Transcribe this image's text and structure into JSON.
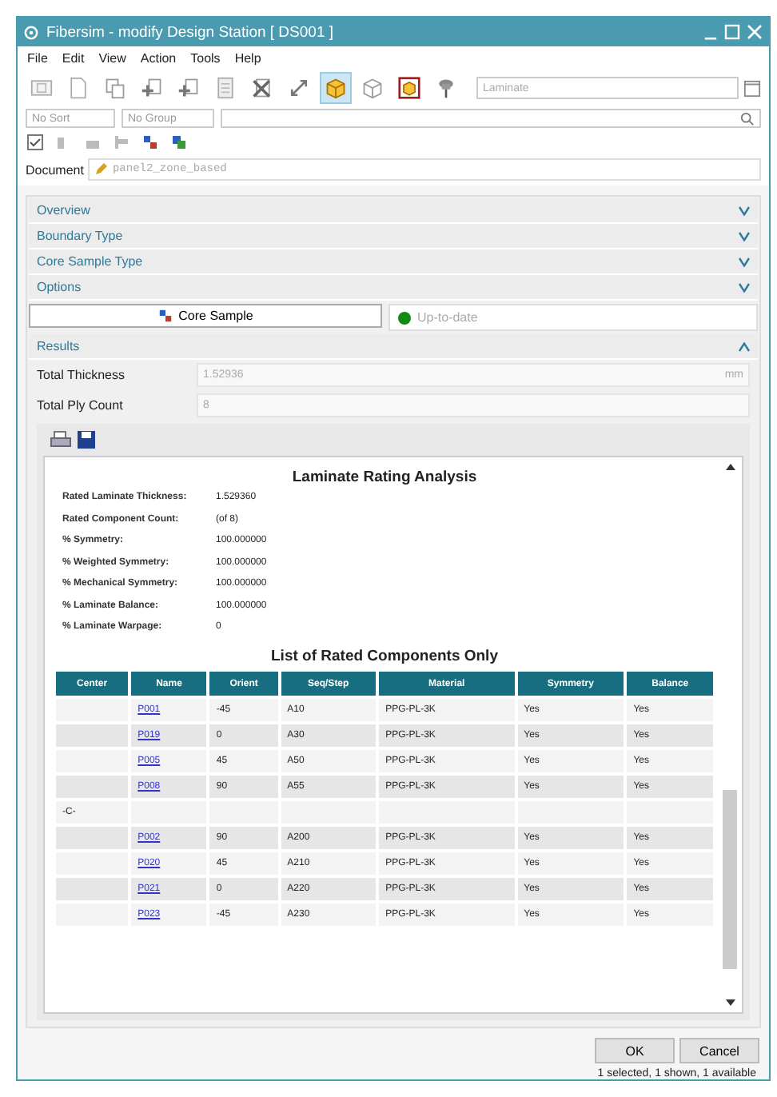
{
  "window": {
    "title": "Fibersim - modify Design Station [ DS001 ]"
  },
  "menu": [
    "File",
    "Edit",
    "View",
    "Action",
    "Tools",
    "Help"
  ],
  "toolbar": [
    {
      "kind": "id",
      "selected": false
    },
    {
      "kind": "page",
      "selected": false
    },
    {
      "kind": "copy",
      "selected": false
    },
    {
      "kind": "add",
      "selected": false
    },
    {
      "kind": "add",
      "selected": false
    },
    {
      "kind": "doc",
      "selected": false
    },
    {
      "kind": "delete",
      "selected": false
    },
    {
      "kind": "move",
      "selected": false
    },
    {
      "kind": "cube-solid",
      "selected": true
    },
    {
      "kind": "cube-wire",
      "selected": false
    },
    {
      "kind": "cube-frame",
      "selected": false
    },
    {
      "kind": "pin",
      "selected": false
    }
  ],
  "laminate": {
    "placeholder": "Laminate"
  },
  "sort": {
    "value": "No Sort"
  },
  "group": {
    "value": "No Group"
  },
  "document": {
    "label": "Document",
    "value": "panel2_zone_based"
  },
  "sections": [
    {
      "title": "Overview",
      "expanded": false
    },
    {
      "title": "Boundary Type",
      "expanded": false
    },
    {
      "title": "Core Sample Type",
      "expanded": false
    },
    {
      "title": "Options",
      "expanded": false
    }
  ],
  "core_sample_button": "Core Sample",
  "status": {
    "text": "Up-to-date",
    "color": "#138a13"
  },
  "results": {
    "title": "Results",
    "expanded": true,
    "fields": [
      {
        "label": "Total Thickness",
        "value": "1.52936",
        "unit": "mm"
      },
      {
        "label": "Total Ply Count",
        "value": "8"
      }
    ],
    "report": {
      "title": "Laminate Rating Analysis",
      "stats": [
        [
          "Rated Laminate Thickness:",
          "1.529360"
        ],
        [
          "Rated Component Count:",
          "(of 8)"
        ],
        [
          "% Symmetry:",
          "100.000000"
        ],
        [
          "% Weighted Symmetry:",
          "100.000000"
        ],
        [
          "% Mechanical Symmetry:",
          "100.000000"
        ],
        [
          "% Laminate Balance:",
          "100.000000"
        ],
        [
          "% Laminate Warpage:",
          "0"
        ]
      ],
      "table_title": "List of Rated Components Only",
      "columns": [
        "Center",
        "Name",
        "Orient",
        "Seq/Step",
        "Material",
        "Symmetry",
        "Balance"
      ],
      "rows": [
        [
          "",
          "P001",
          "-45",
          "A10",
          "PPG-PL-3K",
          "Yes",
          "Yes"
        ],
        [
          "",
          "P019",
          "0",
          "A30",
          "PPG-PL-3K",
          "Yes",
          "Yes"
        ],
        [
          "",
          "P005",
          "45",
          "A50",
          "PPG-PL-3K",
          "Yes",
          "Yes"
        ],
        [
          "",
          "P008",
          "90",
          "A55",
          "PPG-PL-3K",
          "Yes",
          "Yes"
        ],
        [
          "-C-",
          "",
          "",
          "",
          "",
          "",
          ""
        ],
        [
          "",
          "P002",
          "90",
          "A200",
          "PPG-PL-3K",
          "Yes",
          "Yes"
        ],
        [
          "",
          "P020",
          "45",
          "A210",
          "PPG-PL-3K",
          "Yes",
          "Yes"
        ],
        [
          "",
          "P021",
          "0",
          "A220",
          "PPG-PL-3K",
          "Yes",
          "Yes"
        ],
        [
          "",
          "P023",
          "-45",
          "A230",
          "PPG-PL-3K",
          "Yes",
          "Yes"
        ]
      ]
    }
  },
  "buttons": [
    "OK",
    "Cancel"
  ],
  "status_bar": "1 selected, 1 shown, 1 available"
}
